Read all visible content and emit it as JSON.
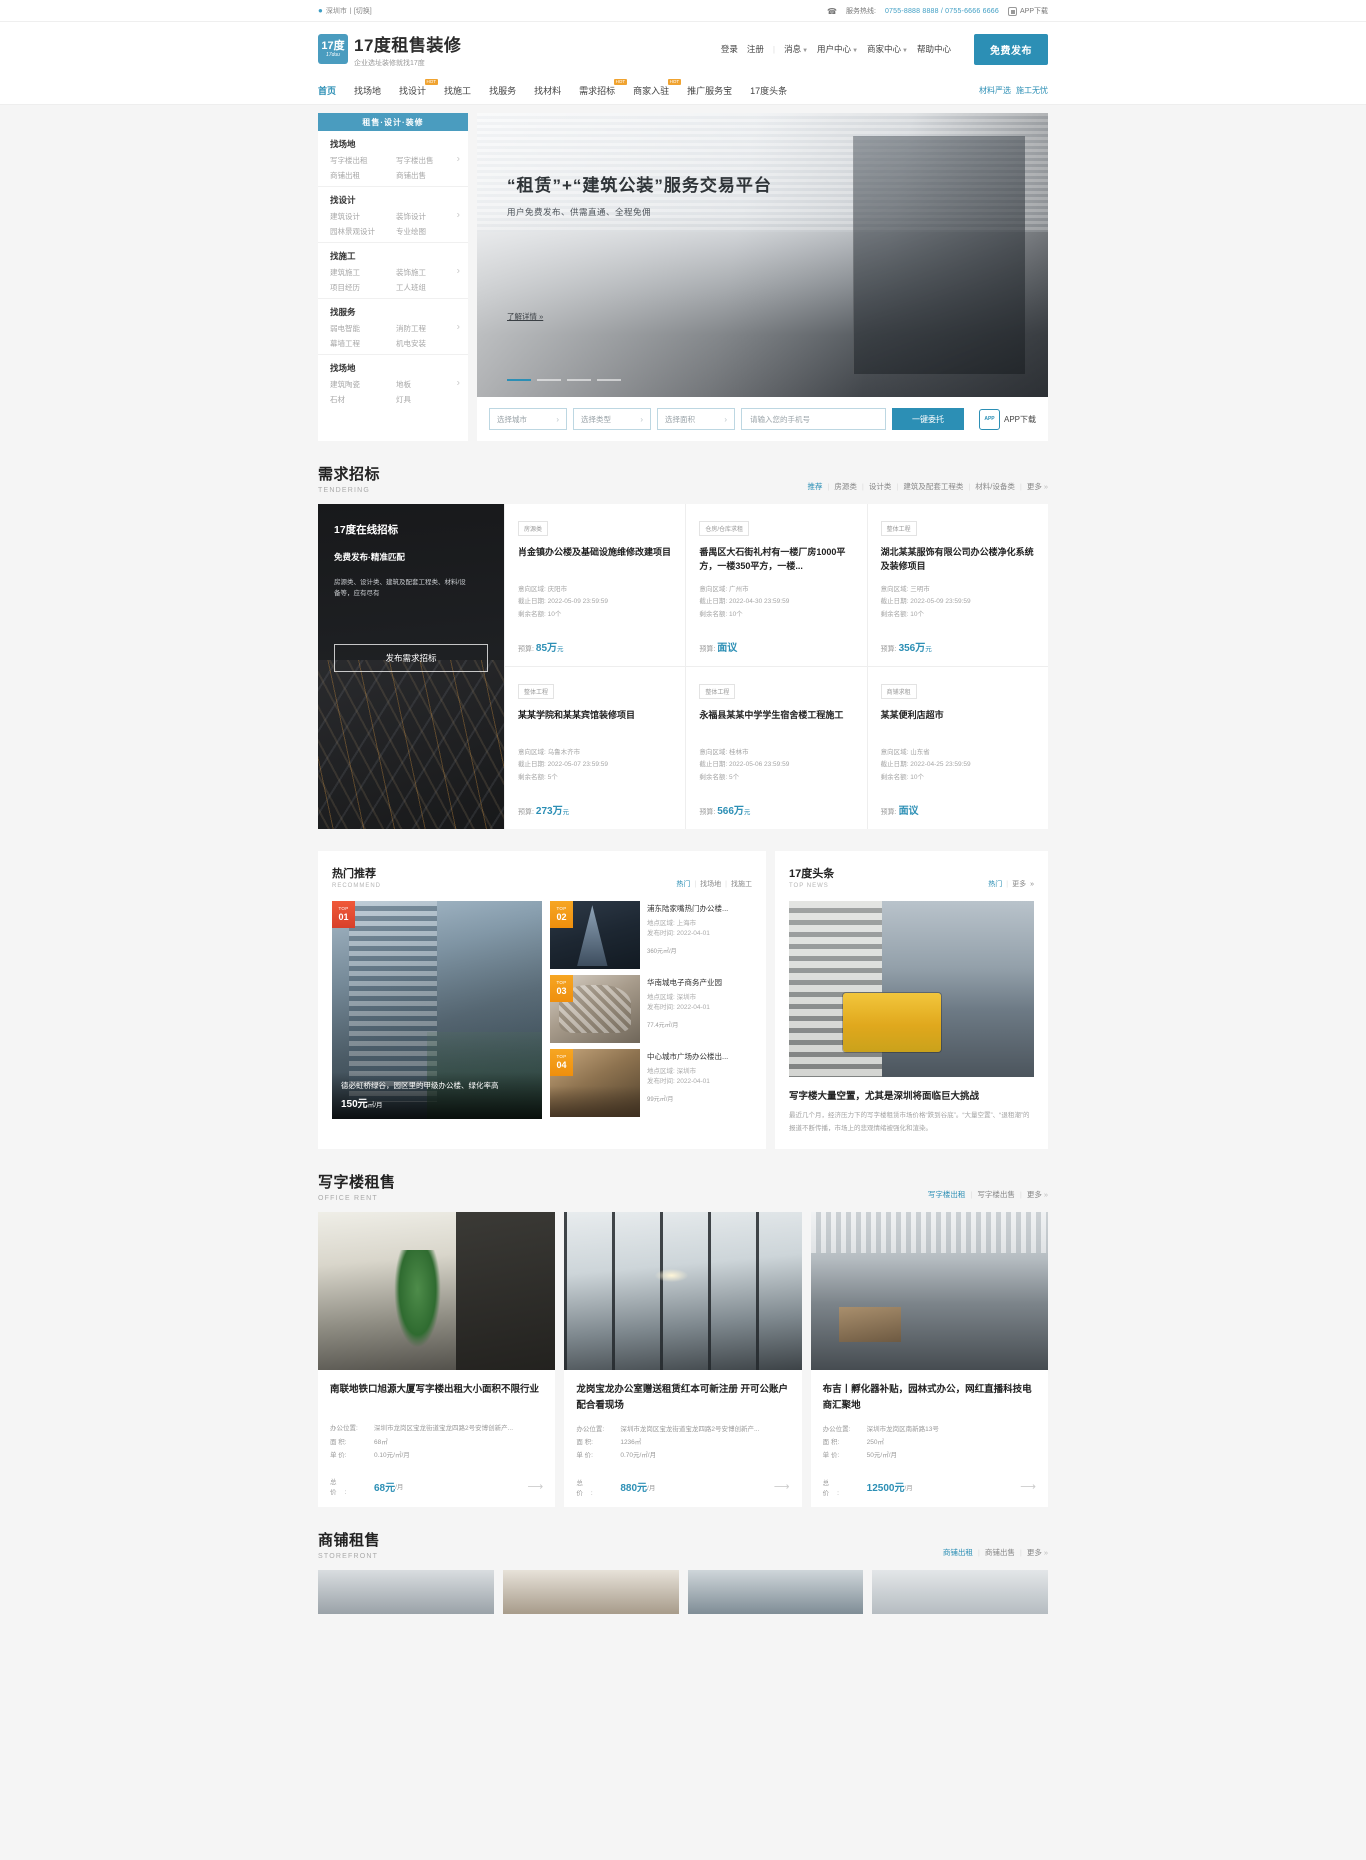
{
  "topbar": {
    "city": "深圳市丨[切换]",
    "pin_icon": "location-pin-icon",
    "hotline_label": "服务热线:",
    "hotline_numbers": "0755-8888 8888 / 0755-6666 6666",
    "app_download": "APP下载"
  },
  "header": {
    "logo_badge_top": "17度",
    "logo_badge_bottom": "17duu",
    "brand_name": "17度租售装修",
    "brand_slogan": "企业选址装修就找17度",
    "nav": [
      {
        "label": "登录",
        "caret": false
      },
      {
        "label": "注册",
        "caret": false
      },
      {
        "label": "消息",
        "caret": true
      },
      {
        "label": "用户中心",
        "caret": true
      },
      {
        "label": "商家中心",
        "caret": true
      },
      {
        "label": "帮助中心",
        "caret": false
      }
    ],
    "publish_button": "免费发布"
  },
  "mainnav": {
    "items": [
      {
        "label": "首页",
        "active": true,
        "tag": ""
      },
      {
        "label": "找场地",
        "active": false,
        "tag": ""
      },
      {
        "label": "找设计",
        "active": false,
        "tag": "HOT"
      },
      {
        "label": "找施工",
        "active": false,
        "tag": ""
      },
      {
        "label": "找服务",
        "active": false,
        "tag": ""
      },
      {
        "label": "找材料",
        "active": false,
        "tag": ""
      },
      {
        "label": "需求招标",
        "active": false,
        "tag": "HOT"
      },
      {
        "label": "商家入驻",
        "active": false,
        "tag": "HOT"
      },
      {
        "label": "推广服务宝",
        "active": false,
        "tag": ""
      },
      {
        "label": "17度头条",
        "active": false,
        "tag": ""
      }
    ],
    "right_links": [
      "材料严选",
      "施工无忧"
    ]
  },
  "category_panel": {
    "header": "租售·设计·装修",
    "blocks": [
      {
        "title": "找场地",
        "links": [
          "写字楼出租",
          "写字楼出售",
          "商铺出租",
          "商铺出售"
        ]
      },
      {
        "title": "找设计",
        "links": [
          "建筑设计",
          "装饰设计",
          "园林景观设计",
          "专业绘图"
        ]
      },
      {
        "title": "找施工",
        "links": [
          "建筑施工",
          "装饰施工",
          "项目经历",
          "工人班组"
        ]
      },
      {
        "title": "找服务",
        "links": [
          "弱电智能",
          "消防工程",
          "幕墙工程",
          "机电安装"
        ]
      },
      {
        "title": "找场地",
        "links": [
          "建筑陶瓷",
          "地板",
          "石材",
          "灯具"
        ]
      }
    ],
    "arrow_icon": "chevron-right-icon"
  },
  "banner": {
    "title": "“租赁”+“建筑公装”服务交易平台",
    "subtitle": "用户免费发布、供需直通、全程免佣",
    "more_link": "了解详情 »",
    "active_dot": 0,
    "dot_count": 4
  },
  "searchbar": {
    "selects": [
      {
        "label": "选择城市"
      },
      {
        "label": "选择类型"
      },
      {
        "label": "选择面积"
      }
    ],
    "phone_placeholder": "请输入您的手机号",
    "phone_value": "",
    "submit_label": "一键委托",
    "app_badge": "APP",
    "app_label": "APP下载"
  },
  "tendering": {
    "title": "需求招标",
    "subtitle": "TENDERING",
    "filters": [
      "推荐",
      "房源类",
      "设计类",
      "建筑及配套工程类",
      "材料/设备类"
    ],
    "active_filter": "推荐",
    "more": "更多",
    "promo": {
      "title": "17度在线招标",
      "subtitle": "免费发布·精准匹配",
      "desc": "房源类、设计类、建筑及配套工程类、材料/设备等，应有尽有",
      "button": "发布需求招标"
    },
    "cards": [
      {
        "category": "房源类",
        "name": "肖金镇办公楼及基础设施维修改建项目",
        "region_label": "意向区域:",
        "region": "庆阳市",
        "deadline_label": "截止日期:",
        "deadline": "2022-05-09 23:59:59",
        "quota_label": "剩余名额:",
        "quota": "10个",
        "budget_label": "预算:",
        "budget": "85万",
        "budget_unit": "元"
      },
      {
        "category": "仓房/仓库求租",
        "name": "番禺区大石街礼村有一楼厂房1000平方，一楼350平方，一楼...",
        "region_label": "意向区域:",
        "region": "广州市",
        "deadline_label": "截止日期:",
        "deadline": "2022-04-30 23:59:59",
        "quota_label": "剩余名额:",
        "quota": "10个",
        "budget_label": "预算:",
        "budget": "面议",
        "budget_unit": ""
      },
      {
        "category": "整体工程",
        "name": "湖北某某服饰有限公司办公楼净化系统及装修项目",
        "region_label": "意向区域:",
        "region": "三明市",
        "deadline_label": "截止日期:",
        "deadline": "2022-05-09 23:59:59",
        "quota_label": "剩余名额:",
        "quota": "10个",
        "budget_label": "预算:",
        "budget": "356万",
        "budget_unit": "元"
      },
      {
        "category": "整体工程",
        "name": "某某学院和某某宾馆装修项目",
        "region_label": "意向区域:",
        "region": "乌鲁木齐市",
        "deadline_label": "截止日期:",
        "deadline": "2022-05-07 23:59:59",
        "quota_label": "剩余名额:",
        "quota": "5个",
        "budget_label": "预算:",
        "budget": "273万",
        "budget_unit": "元"
      },
      {
        "category": "整体工程",
        "name": "永福县某某中学学生宿舍楼工程施工",
        "region_label": "意向区域:",
        "region": "桂林市",
        "deadline_label": "截止日期:",
        "deadline": "2022-05-06 23:59:59",
        "quota_label": "剩余名额:",
        "quota": "5个",
        "budget_label": "预算:",
        "budget": "566万",
        "budget_unit": "元"
      },
      {
        "category": "商铺求租",
        "name": "某某便利店超市",
        "region_label": "意向区域:",
        "region": "山东省",
        "deadline_label": "截止日期:",
        "deadline": "2022-04-25 23:59:59",
        "quota_label": "剩余名额:",
        "quota": "10个",
        "budget_label": "预算:",
        "budget": "面议",
        "budget_unit": ""
      }
    ]
  },
  "recommend": {
    "title": "热门推荐",
    "subtitle": "RECOMMEND",
    "links": [
      "热门",
      "找场地",
      "找施工"
    ],
    "active_link": "热门",
    "featured": {
      "rank_label": "TOP",
      "rank_num": "01",
      "title": "德必虹桥绿谷，园区里的甲级办公楼、绿化率高",
      "price": "150元",
      "price_unit": "㎡/月"
    },
    "items": [
      {
        "rank_label": "TOP",
        "rank_num": "02",
        "title": "浦东陆家嘴热门办公楼...",
        "location_label": "地点区域:",
        "location": "上海市",
        "date_label": "发布时间:",
        "date": "2022-04-01",
        "price": "360元",
        "price_unit": "㎡/月"
      },
      {
        "rank_label": "TOP",
        "rank_num": "03",
        "title": "华南城电子商务产业园",
        "location_label": "地点区域:",
        "location": "深圳市",
        "date_label": "发布时间:",
        "date": "2022-04-01",
        "price": "77.4元",
        "price_unit": "㎡/月"
      },
      {
        "rank_label": "TOP",
        "rank_num": "04",
        "title": "中心城市广场办公楼出...",
        "location_label": "地点区域:",
        "location": "深圳市",
        "date_label": "发布时间:",
        "date": "2022-04-01",
        "price": "99元",
        "price_unit": "㎡/月"
      }
    ]
  },
  "news": {
    "title": "17度头条",
    "subtitle": "TOP NEWS",
    "links": [
      "热门",
      "更多"
    ],
    "active_link": "热门",
    "headline": "写字楼大量空置，尤其是深圳将面临巨大挑战",
    "excerpt": "最近几个月，经济压力下的写字楼租赁市场价格“跌到谷底”。“大量空置”、“退租潮”的报道不断传播，市场上的悲观情绪被强化和渲染。"
  },
  "office_rent": {
    "title": "写字楼租售",
    "subtitle": "OFFICE RENT",
    "links": [
      "写字楼出租",
      "写字楼出售"
    ],
    "active_link": "写字楼出租",
    "more": "更多",
    "cards": [
      {
        "title": "南联地铁口旭源大厦写字楼出租大小面积不限行业",
        "loc_label": "办公位置:",
        "loc": "深圳市龙岗区宝龙街道宝龙四路2号安博创新产...",
        "area_label": "面 积:",
        "area": "68㎡",
        "unit_label": "单 价:",
        "unit": "0.10元/㎡/月",
        "total_label": "总 价:",
        "total": "68元",
        "total_unit": "/月"
      },
      {
        "title": "龙岗宝龙办公室赠送租赁红本可新注册 开可公账户配合看现场",
        "loc_label": "办公位置:",
        "loc": "深圳市龙岗区宝龙街道宝龙四路2号安博创新产...",
        "area_label": "面 积:",
        "area": "1236㎡",
        "unit_label": "单 价:",
        "unit": "0.70元/㎡/月",
        "total_label": "总 价:",
        "total": "880元",
        "total_unit": "/月"
      },
      {
        "title": "布吉丨孵化器补贴，园林式办公，网红直播科技电商汇聚地",
        "loc_label": "办公位置:",
        "loc": "深圳市龙岗区南新路13号",
        "area_label": "面 积:",
        "area": "250㎡",
        "unit_label": "单 价:",
        "unit": "50元/㎡/月",
        "total_label": "总 价:",
        "total": "12500元",
        "total_unit": "/月"
      }
    ],
    "arrow_icon": "arrow-right-icon"
  },
  "storefront": {
    "title": "商铺租售",
    "subtitle": "STOREFRONT",
    "links": [
      "商铺出租",
      "商铺出售"
    ],
    "active_link": "商铺出租",
    "more": "更多"
  },
  "colors": {
    "brand": "#2c8fb5",
    "brand_light": "#4a9cbf",
    "hot_tag": "#f0a330",
    "top_badge_1": "#e8472a",
    "top_badge_2": "#f6a623"
  }
}
